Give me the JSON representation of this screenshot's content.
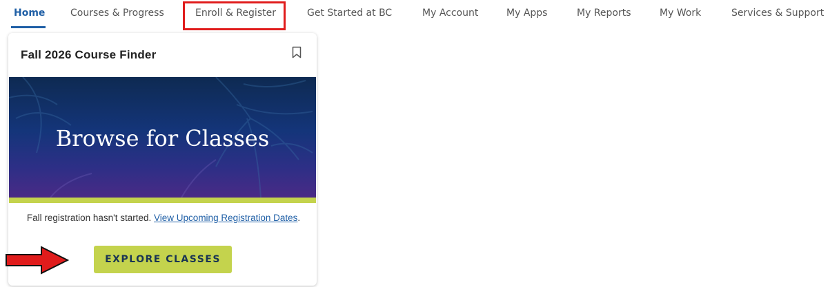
{
  "nav": {
    "items": [
      {
        "label": "Home",
        "active": true
      },
      {
        "label": "Courses & Progress"
      },
      {
        "label": "Enroll & Register",
        "highlighted": true
      },
      {
        "label": "Get Started at BC"
      },
      {
        "label": "My Account"
      },
      {
        "label": "My Apps"
      },
      {
        "label": "My Reports"
      },
      {
        "label": "My Work"
      },
      {
        "label": "Services & Support"
      }
    ]
  },
  "card": {
    "title": "Fall 2026 Course Finder",
    "bookmark_icon": "bookmark-icon",
    "banner_text": "Browse for Classes",
    "registration_text": "Fall registration hasn't started.",
    "registration_link": "View Upcoming Registration Dates",
    "registration_punct": ".",
    "explore_button": "EXPLORE CLASSES"
  },
  "annotations": {
    "highlight_color": "#e01c1c",
    "arrow_icon": "red-arrow-icon"
  },
  "colors": {
    "accent": "#1f5fa6",
    "button": "#c4d34d",
    "banner_top": "#0e2a52",
    "banner_bottom": "#4a2a86"
  }
}
